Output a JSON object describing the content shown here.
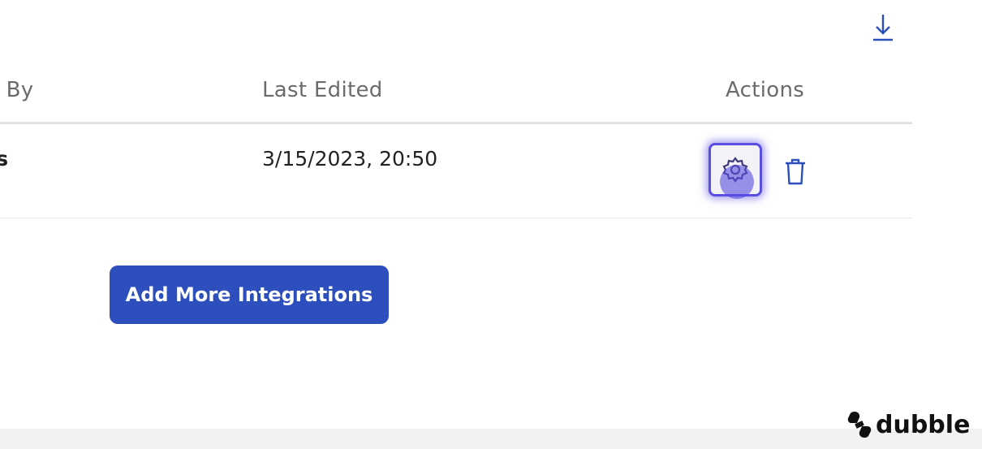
{
  "toolbar": {
    "download_icon": "download-icon"
  },
  "table": {
    "headers": [
      "ed By",
      "Last Edited",
      "Actions"
    ],
    "rows": [
      {
        "creator": "ras",
        "last_edited": "3/15/2023, 20:50",
        "actions": [
          "gear-icon",
          "trash-icon"
        ]
      }
    ]
  },
  "add_button": {
    "label": "Add More Integrations"
  },
  "branding": {
    "text": "dubble",
    "icon": "dubble-logo-icon"
  },
  "colors": {
    "accent": "#2c4fbd",
    "focus_ring": "#5a4fe0",
    "header_text": "#6b6b6b",
    "divider": "#e1e1e1"
  }
}
